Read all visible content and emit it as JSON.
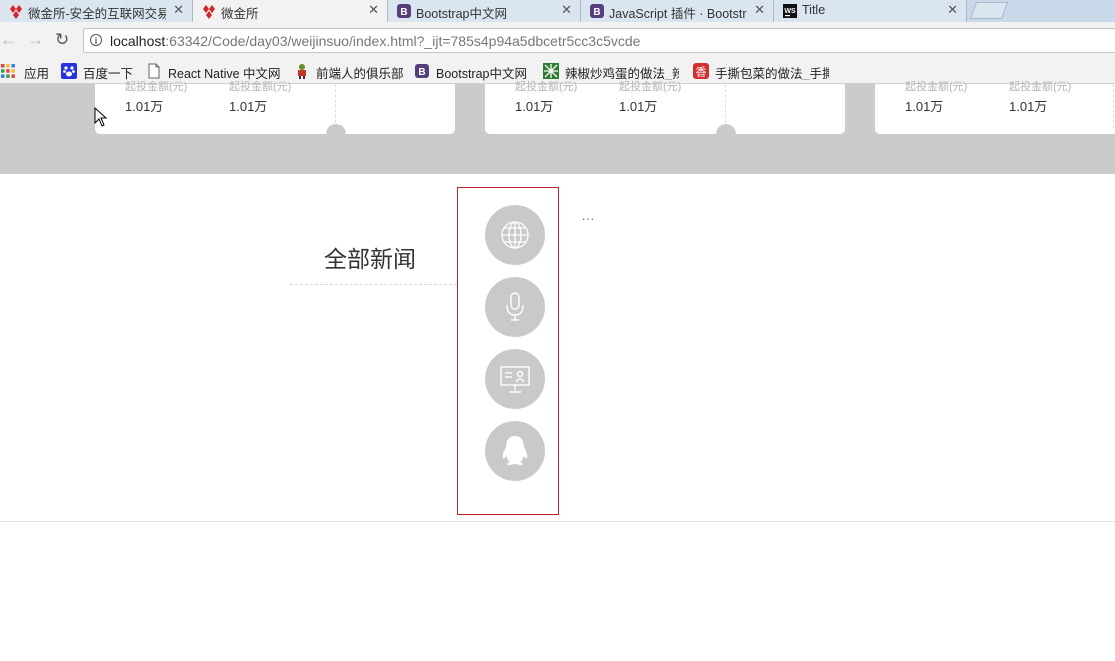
{
  "tabs": [
    {
      "title": "微金所-安全的互联网交易",
      "close": "✕",
      "active": false,
      "icon": "wjs-logo-icon"
    },
    {
      "title": "微金所",
      "close": "✕",
      "active": true,
      "icon": "wjs-logo-icon"
    },
    {
      "title": "Bootstrap中文网",
      "close": "✕",
      "active": false,
      "icon": "bootstrap-icon"
    },
    {
      "title": "JavaScript 插件 · Bootstrap",
      "close": "✕",
      "active": false,
      "icon": "bootstrap-icon"
    },
    {
      "title": "Title",
      "close": "✕",
      "active": false,
      "icon": "webstorm-icon"
    }
  ],
  "toolbar": {
    "back": "←",
    "forward": "→",
    "reload": "↻",
    "url_host": "localhost",
    "url_rest": ":63342/Code/day03/weijinsuo/index.html?_ijt=785s4p94a5dbcetr5cc3c5vcde"
  },
  "bookmarks": [
    {
      "label": "应用",
      "icon": "apps-grid-icon"
    },
    {
      "label": "百度一下",
      "icon": "baidu-paw-icon"
    },
    {
      "label": "React Native 中文网",
      "icon": "page-icon"
    },
    {
      "label": "前端人的俱乐部",
      "icon": "club-icon"
    },
    {
      "label": "Bootstrap中文网",
      "icon": "bootstrap-icon"
    },
    {
      "label": "辣椒炒鸡蛋的做法_辣",
      "icon": "recipe-icon"
    },
    {
      "label": "手撕包菜的做法_手撕",
      "icon": "xiangha-icon"
    }
  ],
  "cards": [
    {
      "cap1": "起投金额(元)",
      "val1": "1.01万",
      "cap2": "起投金额(元)",
      "val2": "1.01万"
    },
    {
      "cap1": "起投金额(元)",
      "val1": "1.01万",
      "cap2": "起投金额(元)",
      "val2": "1.01万"
    },
    {
      "cap1": "起投金额(元)",
      "val1": "1.01万",
      "cap2": "起投金额(元)",
      "val2": "1.01万"
    }
  ],
  "news": {
    "title": "全部新闻",
    "ellipsis": "...",
    "categories": [
      {
        "icon": "globe-icon"
      },
      {
        "icon": "microphone-icon"
      },
      {
        "icon": "presentation-icon"
      },
      {
        "icon": "qq-penguin-icon"
      }
    ]
  },
  "colors": {
    "gray_band": "#cbcbcb",
    "icon_circle": "#c9c9c9",
    "box_border": "#c0232a"
  }
}
